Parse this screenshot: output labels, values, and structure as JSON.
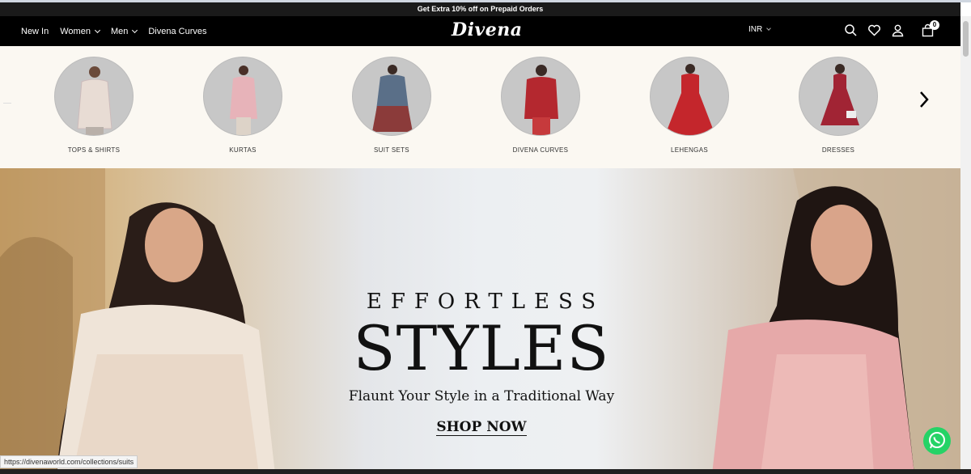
{
  "announcement": "Get Extra 10% off on Prepaid Orders",
  "nav": [
    {
      "label": "New In",
      "dropdown": false
    },
    {
      "label": "Women",
      "dropdown": true
    },
    {
      "label": "Men",
      "dropdown": true
    },
    {
      "label": "Divena Curves",
      "dropdown": false
    }
  ],
  "brand": {
    "logo": "Divena"
  },
  "currency": "INR",
  "header_icons": [
    "search-icon",
    "heart-icon",
    "user-icon",
    "bag-icon"
  ],
  "cart_count": "0",
  "categories": [
    {
      "label": "TOPS & SHIRTS",
      "color": "#e8dcd4"
    },
    {
      "label": "KURTAS",
      "color": "#e7b3b9"
    },
    {
      "label": "SUIT SETS",
      "color": "#5a6f88"
    },
    {
      "label": "DIVENA CURVES",
      "color": "#b4282f"
    },
    {
      "label": "LEHENGAS",
      "color": "#c4262c"
    },
    {
      "label": "DRESSES",
      "color": "#a12434"
    }
  ],
  "hero": {
    "eyebrow": "EFFORTLESS",
    "headline": "STYLES",
    "subheading": "Flaunt Your Style in a Traditional Way",
    "cta": "SHOP NOW"
  },
  "status_url": "https://divenaworld.com/collections/suits",
  "colors": {
    "header_bg": "#000000",
    "category_bg": "#fbf8f2",
    "whatsapp": "#25d366"
  }
}
